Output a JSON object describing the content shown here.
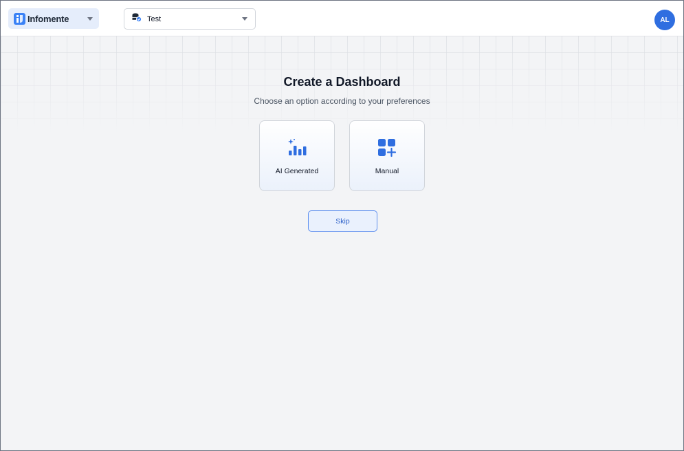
{
  "header": {
    "workspace": {
      "name": "Infomente",
      "icon": "brand-logo-icon"
    },
    "datasource": {
      "label": "Test",
      "icon": "database-check-icon"
    },
    "avatar_initials": "AL"
  },
  "main": {
    "title": "Create a Dashboard",
    "subtitle": "Choose an option according to your preferences",
    "options": [
      {
        "label": "AI Generated",
        "icon": "sparkle-bar-chart-icon"
      },
      {
        "label": "Manual",
        "icon": "grid-plus-icon"
      }
    ],
    "skip_label": "Skip"
  },
  "colors": {
    "accent": "#2f6ee0",
    "workspace_bg": "#e5edfb",
    "page_bg": "#f3f4f6"
  }
}
